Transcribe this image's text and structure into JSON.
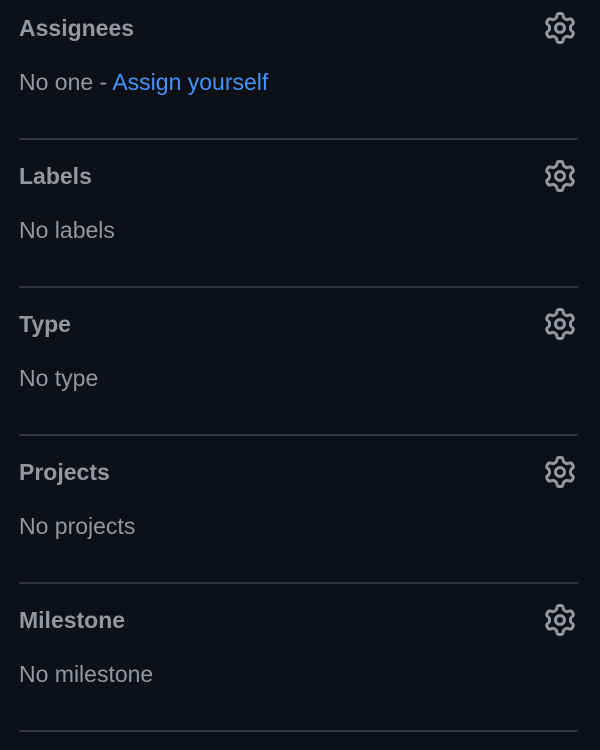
{
  "sidebar": {
    "assignees": {
      "title": "Assignees",
      "empty_text": "No one - ",
      "link_text": "Assign yourself",
      "icon": "gear-icon"
    },
    "labels": {
      "title": "Labels",
      "value": "No labels",
      "icon": "gear-icon"
    },
    "type": {
      "title": "Type",
      "value": "No type",
      "icon": "gear-icon"
    },
    "projects": {
      "title": "Projects",
      "value": "No projects",
      "icon": "gear-icon"
    },
    "milestone": {
      "title": "Milestone",
      "value": "No milestone",
      "icon": "gear-icon"
    }
  },
  "colors": {
    "background": "#0d1117",
    "text_muted": "#9198a1",
    "link": "#4493f8",
    "divider": "#30363d"
  }
}
